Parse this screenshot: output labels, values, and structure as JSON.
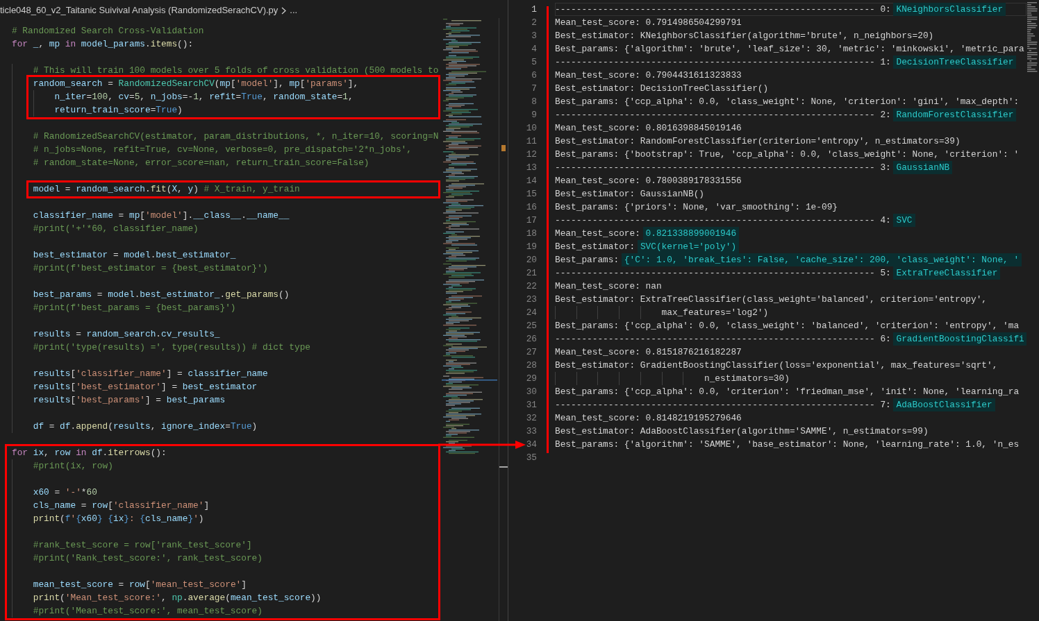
{
  "breadcrumb": {
    "items": [
      {
        "text": "ticle048_60_v2_Taitanic Suivival Analysis (RandomizedSerachCV).py"
      },
      {
        "text": "..."
      }
    ]
  },
  "editor": {
    "sections": [
      {
        "boxed": false,
        "lines": [
          {
            "kind": "code",
            "tokens": [
              {
                "kind": "comment",
                "text": "# Randomized Search Cross-Validation"
              }
            ]
          },
          {
            "kind": "code",
            "tokens": [
              {
                "kind": "keyword",
                "text": "for "
              },
              {
                "kind": "variable",
                "text": "_"
              },
              {
                "kind": "plain",
                "text": ", "
              },
              {
                "kind": "variable",
                "text": "mp "
              },
              {
                "kind": "keyword",
                "text": "in "
              },
              {
                "kind": "variable",
                "text": "model_params"
              },
              {
                "kind": "plain",
                "text": "."
              },
              {
                "kind": "function",
                "text": "items"
              },
              {
                "kind": "plain",
                "text": "():"
              }
            ]
          },
          {
            "kind": "blank"
          },
          {
            "kind": "code",
            "tokens": [
              {
                "kind": "comment",
                "text": "    # This will train 100 models over 5 folds of cross validation (500 models to"
              }
            ]
          }
        ]
      },
      {
        "boxed": true,
        "lines": [
          {
            "kind": "code",
            "tokens": [
              {
                "kind": "variable",
                "text": "    random_search"
              },
              {
                "kind": "plain",
                "text": " = "
              },
              {
                "kind": "class",
                "text": "RandomizedSearchCV"
              },
              {
                "kind": "plain",
                "text": "("
              },
              {
                "kind": "variable",
                "text": "mp"
              },
              {
                "kind": "plain",
                "text": "["
              },
              {
                "kind": "string",
                "text": "'model'"
              },
              {
                "kind": "plain",
                "text": "], "
              },
              {
                "kind": "variable",
                "text": "mp"
              },
              {
                "kind": "plain",
                "text": "["
              },
              {
                "kind": "string",
                "text": "'params'"
              },
              {
                "kind": "plain",
                "text": "],"
              }
            ]
          },
          {
            "kind": "code",
            "tokens": [
              {
                "kind": "variable",
                "text": "        n_iter"
              },
              {
                "kind": "plain",
                "text": "="
              },
              {
                "kind": "number",
                "text": "100"
              },
              {
                "kind": "plain",
                "text": ", "
              },
              {
                "kind": "variable",
                "text": "cv"
              },
              {
                "kind": "plain",
                "text": "="
              },
              {
                "kind": "number",
                "text": "5"
              },
              {
                "kind": "plain",
                "text": ", "
              },
              {
                "kind": "variable",
                "text": "n_jobs"
              },
              {
                "kind": "plain",
                "text": "=-"
              },
              {
                "kind": "number",
                "text": "1"
              },
              {
                "kind": "plain",
                "text": ", "
              },
              {
                "kind": "variable",
                "text": "refit"
              },
              {
                "kind": "plain",
                "text": "="
              },
              {
                "kind": "constant",
                "text": "True"
              },
              {
                "kind": "plain",
                "text": ", "
              },
              {
                "kind": "variable",
                "text": "random_state"
              },
              {
                "kind": "plain",
                "text": "="
              },
              {
                "kind": "number",
                "text": "1"
              },
              {
                "kind": "plain",
                "text": ","
              }
            ]
          },
          {
            "kind": "code",
            "tokens": [
              {
                "kind": "variable",
                "text": "        return_train_score"
              },
              {
                "kind": "plain",
                "text": "="
              },
              {
                "kind": "constant",
                "text": "True"
              },
              {
                "kind": "plain",
                "text": ")"
              }
            ]
          }
        ]
      },
      {
        "boxed": false,
        "lines": [
          {
            "kind": "blank"
          },
          {
            "kind": "code",
            "tokens": [
              {
                "kind": "comment",
                "text": "    # RandomizedSearchCV(estimator, param_distributions, *, n_iter=10, scoring=N"
              }
            ]
          },
          {
            "kind": "code",
            "tokens": [
              {
                "kind": "comment",
                "text": "    # n_jobs=None, refit=True, cv=None, verbose=0, pre_dispatch='2*n_jobs',"
              }
            ]
          },
          {
            "kind": "code",
            "tokens": [
              {
                "kind": "comment",
                "text": "    # random_state=None, error_score=nan, return_train_score=False)"
              }
            ]
          },
          {
            "kind": "blank"
          }
        ]
      },
      {
        "boxed": true,
        "lines": [
          {
            "kind": "code",
            "tokens": [
              {
                "kind": "variable",
                "text": "    model"
              },
              {
                "kind": "plain",
                "text": " = "
              },
              {
                "kind": "variable",
                "text": "random_search"
              },
              {
                "kind": "plain",
                "text": "."
              },
              {
                "kind": "function",
                "text": "fit"
              },
              {
                "kind": "plain",
                "text": "("
              },
              {
                "kind": "variable",
                "text": "X"
              },
              {
                "kind": "plain",
                "text": ", "
              },
              {
                "kind": "variable",
                "text": "y"
              },
              {
                "kind": "plain",
                "text": ") "
              },
              {
                "kind": "comment",
                "text": "# X_train, y_train"
              }
            ]
          }
        ]
      },
      {
        "boxed": false,
        "lines": [
          {
            "kind": "blank"
          },
          {
            "kind": "code",
            "tokens": [
              {
                "kind": "variable",
                "text": "    classifier_name"
              },
              {
                "kind": "plain",
                "text": " = "
              },
              {
                "kind": "variable",
                "text": "mp"
              },
              {
                "kind": "plain",
                "text": "["
              },
              {
                "kind": "string",
                "text": "'model'"
              },
              {
                "kind": "plain",
                "text": "]."
              },
              {
                "kind": "variable",
                "text": "__class__"
              },
              {
                "kind": "plain",
                "text": "."
              },
              {
                "kind": "variable",
                "text": "__name__"
              }
            ]
          },
          {
            "kind": "code",
            "tokens": [
              {
                "kind": "comment",
                "text": "    #print('+'*60, classifier_name)"
              }
            ]
          },
          {
            "kind": "blank"
          },
          {
            "kind": "code",
            "tokens": [
              {
                "kind": "variable",
                "text": "    best_estimator"
              },
              {
                "kind": "plain",
                "text": " = "
              },
              {
                "kind": "variable",
                "text": "model"
              },
              {
                "kind": "plain",
                "text": "."
              },
              {
                "kind": "variable",
                "text": "best_estimator_"
              }
            ]
          },
          {
            "kind": "code",
            "tokens": [
              {
                "kind": "comment",
                "text": "    #print(f'best_estimator = {best_estimator}')"
              }
            ]
          },
          {
            "kind": "blank"
          },
          {
            "kind": "code",
            "tokens": [
              {
                "kind": "variable",
                "text": "    best_params"
              },
              {
                "kind": "plain",
                "text": " = "
              },
              {
                "kind": "variable",
                "text": "model"
              },
              {
                "kind": "plain",
                "text": "."
              },
              {
                "kind": "variable",
                "text": "best_estimator_"
              },
              {
                "kind": "plain",
                "text": "."
              },
              {
                "kind": "function",
                "text": "get_params"
              },
              {
                "kind": "plain",
                "text": "()"
              }
            ]
          },
          {
            "kind": "code",
            "tokens": [
              {
                "kind": "comment",
                "text": "    #print(f'best_params = {best_params}')"
              }
            ]
          },
          {
            "kind": "blank"
          },
          {
            "kind": "code",
            "tokens": [
              {
                "kind": "variable",
                "text": "    results"
              },
              {
                "kind": "plain",
                "text": " = "
              },
              {
                "kind": "variable",
                "text": "random_search"
              },
              {
                "kind": "plain",
                "text": "."
              },
              {
                "kind": "variable",
                "text": "cv_results_"
              }
            ]
          },
          {
            "kind": "code",
            "tokens": [
              {
                "kind": "comment",
                "text": "    #print('type(results) =', type(results)) # dict type"
              }
            ]
          },
          {
            "kind": "blank"
          },
          {
            "kind": "code",
            "tokens": [
              {
                "kind": "variable",
                "text": "    results"
              },
              {
                "kind": "plain",
                "text": "["
              },
              {
                "kind": "string",
                "text": "'classifier_name'"
              },
              {
                "kind": "plain",
                "text": "] = "
              },
              {
                "kind": "variable",
                "text": "classifier_name"
              }
            ]
          },
          {
            "kind": "code",
            "tokens": [
              {
                "kind": "variable",
                "text": "    results"
              },
              {
                "kind": "plain",
                "text": "["
              },
              {
                "kind": "string",
                "text": "'best_estimator'"
              },
              {
                "kind": "plain",
                "text": "] = "
              },
              {
                "kind": "variable",
                "text": "best_estimator"
              }
            ]
          },
          {
            "kind": "code",
            "tokens": [
              {
                "kind": "variable",
                "text": "    results"
              },
              {
                "kind": "plain",
                "text": "["
              },
              {
                "kind": "string",
                "text": "'best_params'"
              },
              {
                "kind": "plain",
                "text": "] = "
              },
              {
                "kind": "variable",
                "text": "best_params"
              }
            ]
          },
          {
            "kind": "blank"
          },
          {
            "kind": "code",
            "tokens": [
              {
                "kind": "variable",
                "text": "    df"
              },
              {
                "kind": "plain",
                "text": " = "
              },
              {
                "kind": "variable",
                "text": "df"
              },
              {
                "kind": "plain",
                "text": "."
              },
              {
                "kind": "function",
                "text": "append"
              },
              {
                "kind": "plain",
                "text": "("
              },
              {
                "kind": "variable",
                "text": "results"
              },
              {
                "kind": "plain",
                "text": ", "
              },
              {
                "kind": "variable",
                "text": "ignore_index"
              },
              {
                "kind": "plain",
                "text": "="
              },
              {
                "kind": "constant",
                "text": "True"
              },
              {
                "kind": "plain",
                "text": ")"
              }
            ]
          },
          {
            "kind": "blank"
          }
        ]
      },
      {
        "boxed": true,
        "lines": [
          {
            "kind": "code",
            "tokens": [
              {
                "kind": "keyword",
                "text": "for "
              },
              {
                "kind": "variable",
                "text": "ix"
              },
              {
                "kind": "plain",
                "text": ", "
              },
              {
                "kind": "variable",
                "text": "row "
              },
              {
                "kind": "keyword",
                "text": "in "
              },
              {
                "kind": "variable",
                "text": "df"
              },
              {
                "kind": "plain",
                "text": "."
              },
              {
                "kind": "function",
                "text": "iterrows"
              },
              {
                "kind": "plain",
                "text": "():"
              }
            ]
          },
          {
            "kind": "code",
            "tokens": [
              {
                "kind": "comment",
                "text": "    #print(ix, row)"
              }
            ]
          },
          {
            "kind": "blank"
          },
          {
            "kind": "code",
            "tokens": [
              {
                "kind": "variable",
                "text": "    x60"
              },
              {
                "kind": "plain",
                "text": " = "
              },
              {
                "kind": "string",
                "text": "'-'"
              },
              {
                "kind": "plain",
                "text": "*"
              },
              {
                "kind": "number",
                "text": "60"
              }
            ]
          },
          {
            "kind": "code",
            "tokens": [
              {
                "kind": "variable",
                "text": "    cls_name"
              },
              {
                "kind": "plain",
                "text": " = "
              },
              {
                "kind": "variable",
                "text": "row"
              },
              {
                "kind": "plain",
                "text": "["
              },
              {
                "kind": "string",
                "text": "'classifier_name'"
              },
              {
                "kind": "plain",
                "text": "]"
              }
            ]
          },
          {
            "kind": "code",
            "tokens": [
              {
                "kind": "function",
                "text": "    print"
              },
              {
                "kind": "plain",
                "text": "("
              },
              {
                "kind": "constant",
                "text": "f"
              },
              {
                "kind": "string",
                "text": "'"
              },
              {
                "kind": "constant",
                "text": "{"
              },
              {
                "kind": "variable",
                "text": "x60"
              },
              {
                "kind": "constant",
                "text": "} {"
              },
              {
                "kind": "variable",
                "text": "ix"
              },
              {
                "kind": "constant",
                "text": "}"
              },
              {
                "kind": "string",
                "text": ": "
              },
              {
                "kind": "constant",
                "text": "{"
              },
              {
                "kind": "variable",
                "text": "cls_name"
              },
              {
                "kind": "constant",
                "text": "}"
              },
              {
                "kind": "string",
                "text": "'"
              },
              {
                "kind": "plain",
                "text": ")"
              }
            ]
          },
          {
            "kind": "blank"
          },
          {
            "kind": "code",
            "tokens": [
              {
                "kind": "comment",
                "text": "    #rank_test_score = row['rank_test_score']"
              }
            ]
          },
          {
            "kind": "code",
            "tokens": [
              {
                "kind": "comment",
                "text": "    #print('Rank_test_score:', rank_test_score)"
              }
            ]
          },
          {
            "kind": "blank"
          },
          {
            "kind": "code",
            "tokens": [
              {
                "kind": "variable",
                "text": "    mean_test_score"
              },
              {
                "kind": "plain",
                "text": " = "
              },
              {
                "kind": "variable",
                "text": "row"
              },
              {
                "kind": "plain",
                "text": "["
              },
              {
                "kind": "string",
                "text": "'mean_test_score'"
              },
              {
                "kind": "plain",
                "text": "]"
              }
            ]
          },
          {
            "kind": "code",
            "tokens": [
              {
                "kind": "function",
                "text": "    print"
              },
              {
                "kind": "plain",
                "text": "("
              },
              {
                "kind": "string",
                "text": "'Mean_test_score:'"
              },
              {
                "kind": "plain",
                "text": ", "
              },
              {
                "kind": "class",
                "text": "np"
              },
              {
                "kind": "plain",
                "text": "."
              },
              {
                "kind": "function",
                "text": "average"
              },
              {
                "kind": "plain",
                "text": "("
              },
              {
                "kind": "variable",
                "text": "mean_test_score"
              },
              {
                "kind": "plain",
                "text": "))"
              }
            ]
          },
          {
            "kind": "code",
            "tokens": [
              {
                "kind": "comment",
                "text": "    #print('Mean_test_score:', mean_test_score)"
              }
            ]
          }
        ]
      }
    ]
  },
  "annotation_arrow": true,
  "output": {
    "sections": [
      {
        "marked": true,
        "lines": [
          {
            "number": "1",
            "current": true,
            "segments": [
              {
                "text": "------------------------------------------------------------ 0: ",
                "highlight": false
              },
              {
                "text": "KNeighborsClassifier",
                "highlight": true
              }
            ]
          },
          {
            "number": "2",
            "current": false,
            "segments": [
              {
                "text": "Mean_test_score: 0.7914986504299791",
                "highlight": false
              }
            ]
          },
          {
            "number": "3",
            "current": false,
            "segments": [
              {
                "text": "Best_estimator: KNeighborsClassifier(algorithm='brute', n_neighbors=20)",
                "highlight": false
              }
            ]
          },
          {
            "number": "4",
            "current": false,
            "segments": [
              {
                "text": "Best_params: {'algorithm': 'brute', 'leaf_size': 30, 'metric': 'minkowski', 'metric_para",
                "highlight": false
              }
            ]
          },
          {
            "number": "5",
            "current": false,
            "segments": [
              {
                "text": "------------------------------------------------------------ 1: ",
                "highlight": false
              },
              {
                "text": "DecisionTreeClassifier",
                "highlight": true
              }
            ]
          },
          {
            "number": "6",
            "current": false,
            "segments": [
              {
                "text": "Mean_test_score: 0.7904431611323833",
                "highlight": false
              }
            ]
          },
          {
            "number": "7",
            "current": false,
            "segments": [
              {
                "text": "Best_estimator: DecisionTreeClassifier()",
                "highlight": false
              }
            ]
          },
          {
            "number": "8",
            "current": false,
            "segments": [
              {
                "text": "Best_params: {'ccp_alpha': 0.0, 'class_weight': None, 'criterion': 'gini', 'max_depth':",
                "highlight": false
              }
            ]
          },
          {
            "number": "9",
            "current": false,
            "segments": [
              {
                "text": "------------------------------------------------------------ 2: ",
                "highlight": false
              },
              {
                "text": "RandomForestClassifier",
                "highlight": true
              }
            ]
          },
          {
            "number": "10",
            "current": false,
            "segments": [
              {
                "text": "Mean_test_score: 0.8016398845019146",
                "highlight": false
              }
            ]
          },
          {
            "number": "11",
            "current": false,
            "segments": [
              {
                "text": "Best_estimator: RandomForestClassifier(criterion='entropy', n_estimators=39)",
                "highlight": false
              }
            ]
          },
          {
            "number": "12",
            "current": false,
            "segments": [
              {
                "text": "Best_params: {'bootstrap': True, 'ccp_alpha': 0.0, 'class_weight': None, 'criterion': '",
                "highlight": false
              }
            ]
          },
          {
            "number": "13",
            "current": false,
            "segments": [
              {
                "text": "------------------------------------------------------------ 3: ",
                "highlight": false
              },
              {
                "text": "GaussianNB",
                "highlight": true
              }
            ]
          },
          {
            "number": "14",
            "current": false,
            "segments": [
              {
                "text": "Mean_test_score: 0.7800389178331556",
                "highlight": false
              }
            ]
          },
          {
            "number": "15",
            "current": false,
            "segments": [
              {
                "text": "Best_estimator: GaussianNB()",
                "highlight": false
              }
            ]
          },
          {
            "number": "16",
            "current": false,
            "segments": [
              {
                "text": "Best_params: {'priors': None, 'var_smoothing': 1e-09}",
                "highlight": false
              }
            ]
          },
          {
            "number": "17",
            "current": false,
            "segments": [
              {
                "text": "------------------------------------------------------------ 4: ",
                "highlight": false
              },
              {
                "text": "SVC",
                "highlight": true
              }
            ]
          },
          {
            "number": "18",
            "current": false,
            "segments": [
              {
                "text": "Mean_test_score: ",
                "highlight": false
              },
              {
                "text": "0.821338899001946",
                "highlight": true
              }
            ]
          },
          {
            "number": "19",
            "current": false,
            "segments": [
              {
                "text": "Best_estimator: ",
                "highlight": false
              },
              {
                "text": "SVC(kernel='poly')",
                "highlight": true
              }
            ]
          },
          {
            "number": "20",
            "current": false,
            "segments": [
              {
                "text": "Best_params: ",
                "highlight": false
              },
              {
                "text": "{'C': 1.0, 'break_ties': False, 'cache_size': 200, 'class_weight': None, '",
                "highlight": true
              }
            ]
          },
          {
            "number": "21",
            "current": false,
            "segments": [
              {
                "text": "------------------------------------------------------------ 5: ",
                "highlight": false
              },
              {
                "text": "ExtraTreeClassifier",
                "highlight": true
              }
            ]
          },
          {
            "number": "22",
            "current": false,
            "segments": [
              {
                "text": "Mean_test_score: nan",
                "highlight": false
              }
            ]
          },
          {
            "number": "23",
            "current": false,
            "segments": [
              {
                "text": "Best_estimator: ExtraTreeClassifier(class_weight='balanced', criterion='entropy',",
                "highlight": false
              }
            ]
          },
          {
            "number": "24",
            "current": false,
            "segments": [
              {
                "text": "                    max_features='log2')",
                "highlight": false
              }
            ]
          },
          {
            "number": "25",
            "current": false,
            "segments": [
              {
                "text": "Best_params: {'ccp_alpha': 0.0, 'class_weight': 'balanced', 'criterion': 'entropy', 'ma",
                "highlight": false
              }
            ]
          },
          {
            "number": "26",
            "current": false,
            "segments": [
              {
                "text": "------------------------------------------------------------ 6: ",
                "highlight": false
              },
              {
                "text": "GradientBoostingClassifi",
                "highlight": true
              }
            ]
          },
          {
            "number": "27",
            "current": false,
            "segments": [
              {
                "text": "Mean_test_score: 0.8151876216182287",
                "highlight": false
              }
            ]
          },
          {
            "number": "28",
            "current": false,
            "segments": [
              {
                "text": "Best_estimator: GradientBoostingClassifier(loss='exponential', max_features='sqrt',",
                "highlight": false
              }
            ]
          },
          {
            "number": "29",
            "current": false,
            "segments": [
              {
                "text": "                            n_estimators=30)",
                "highlight": false
              }
            ]
          },
          {
            "number": "30",
            "current": false,
            "segments": [
              {
                "text": "Best_params: {'ccp_alpha': 0.0, 'criterion': 'friedman_mse', 'init': None, 'learning_ra",
                "highlight": false
              }
            ]
          },
          {
            "number": "31",
            "current": false,
            "segments": [
              {
                "text": "------------------------------------------------------------ 7: ",
                "highlight": false
              },
              {
                "text": "AdaBoostClassifier",
                "highlight": true
              }
            ]
          },
          {
            "number": "32",
            "current": false,
            "segments": [
              {
                "text": "Mean_test_score: 0.8148219195279646",
                "highlight": false
              }
            ]
          },
          {
            "number": "33",
            "current": false,
            "segments": [
              {
                "text": "Best_estimator: AdaBoostClassifier(algorithm='SAMME', n_estimators=99)",
                "highlight": false
              }
            ]
          },
          {
            "number": "34",
            "current": false,
            "segments": [
              {
                "text": "Best_params: {'algorithm': 'SAMME', 'base_estimator': None, 'learning_rate': 1.0, 'n_es",
                "highlight": false
              }
            ]
          }
        ]
      },
      {
        "marked": false,
        "lines": [
          {
            "number": "35",
            "current": false
          }
        ]
      }
    ]
  }
}
